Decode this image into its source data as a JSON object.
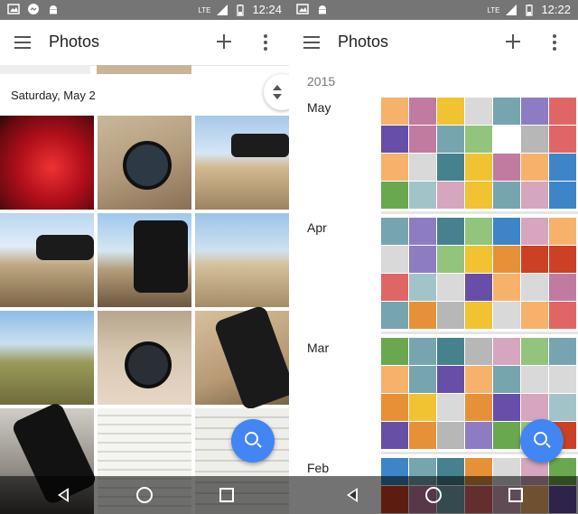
{
  "left": {
    "status": {
      "time": "12:24",
      "signal": "LTE"
    },
    "appbar": {
      "title": "Photos"
    },
    "date_header": "Saturday, May 2"
  },
  "right": {
    "status": {
      "time": "12:22",
      "signal": "LTE"
    },
    "appbar": {
      "title": "Photos"
    },
    "year": "2015",
    "months": [
      "May",
      "Apr",
      "Mar",
      "Feb"
    ]
  },
  "colors": {
    "status_bar": "#757575",
    "fab": "#4285f4",
    "nav_bar": "#333333"
  }
}
